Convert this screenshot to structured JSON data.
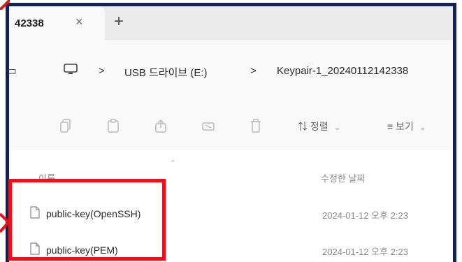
{
  "tab": {
    "title": "42338",
    "close_glyph": "×",
    "new_tab_glyph": "+"
  },
  "address": {
    "back_glyph": "▭",
    "separator": ">",
    "crumbs": [
      "USB 드라이브 (E:)",
      "Keypair-1_20240112142338"
    ]
  },
  "toolbar": {
    "icons": [
      "copy-icon",
      "paste-icon",
      "share-icon",
      "rename-icon",
      "delete-icon"
    ],
    "sort_icon": "⇅",
    "sort_label": "정렬",
    "view_icon": "≡",
    "view_label": "보기",
    "chevron": "⌄"
  },
  "columns": {
    "name": "이름",
    "date": "수정한 날짜",
    "sort_caret": "^"
  },
  "files": [
    {
      "name": "public-key(OpenSSH)",
      "date": "2024-01-12 오후 2:23"
    },
    {
      "name": "public-key(PEM)",
      "date": "2024-01-12 오후 2:23"
    }
  ],
  "colors": {
    "frame": "#14224f",
    "highlight": "#e8121c"
  }
}
